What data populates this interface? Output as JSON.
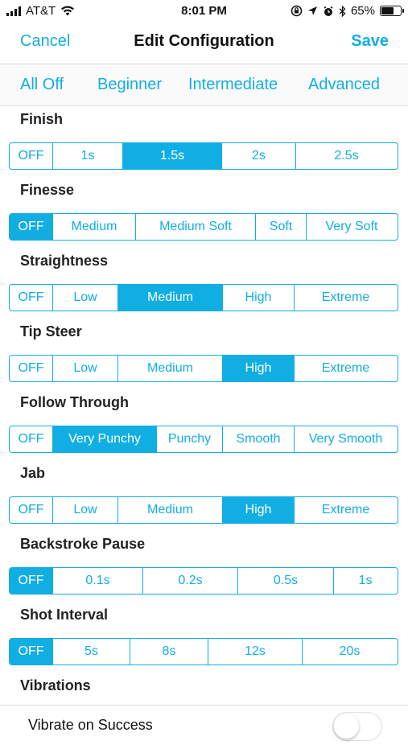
{
  "status": {
    "carrier": "AT&T",
    "time": "8:01 PM",
    "battery": "65%",
    "battery_level": 0.65
  },
  "nav": {
    "cancel": "Cancel",
    "title": "Edit Configuration",
    "save": "Save"
  },
  "presets": [
    "All Off",
    "Beginner",
    "Intermediate",
    "Advanced"
  ],
  "sections": [
    {
      "title": "Finish",
      "options": [
        "OFF",
        "1s",
        "1.5s",
        "2s",
        "2.5s"
      ],
      "selected": 2
    },
    {
      "title": "Finesse",
      "options": [
        "OFF",
        "Medium",
        "Medium Soft",
        "Soft",
        "Very Soft"
      ],
      "selected": 0
    },
    {
      "title": "Straightness",
      "options": [
        "OFF",
        "Low",
        "Medium",
        "High",
        "Extreme"
      ],
      "selected": 2
    },
    {
      "title": "Tip Steer",
      "options": [
        "OFF",
        "Low",
        "Medium",
        "High",
        "Extreme"
      ],
      "selected": 3
    },
    {
      "title": "Follow Through",
      "options": [
        "OFF",
        "Very Punchy",
        "Punchy",
        "Smooth",
        "Very Smooth"
      ],
      "selected": 1
    },
    {
      "title": "Jab",
      "options": [
        "OFF",
        "Low",
        "Medium",
        "High",
        "Extreme"
      ],
      "selected": 3
    },
    {
      "title": "Backstroke Pause",
      "options": [
        "OFF",
        "0.1s",
        "0.2s",
        "0.5s",
        "1s"
      ],
      "selected": 0
    },
    {
      "title": "Shot Interval",
      "options": [
        "OFF",
        "5s",
        "8s",
        "12s",
        "20s"
      ],
      "selected": 0
    }
  ],
  "vibrations": {
    "title": "Vibrations",
    "row_label": "Vibrate on Success",
    "toggle_on": false
  },
  "colors": {
    "accent": "#11aee3",
    "selected_text": "#ffffff"
  }
}
